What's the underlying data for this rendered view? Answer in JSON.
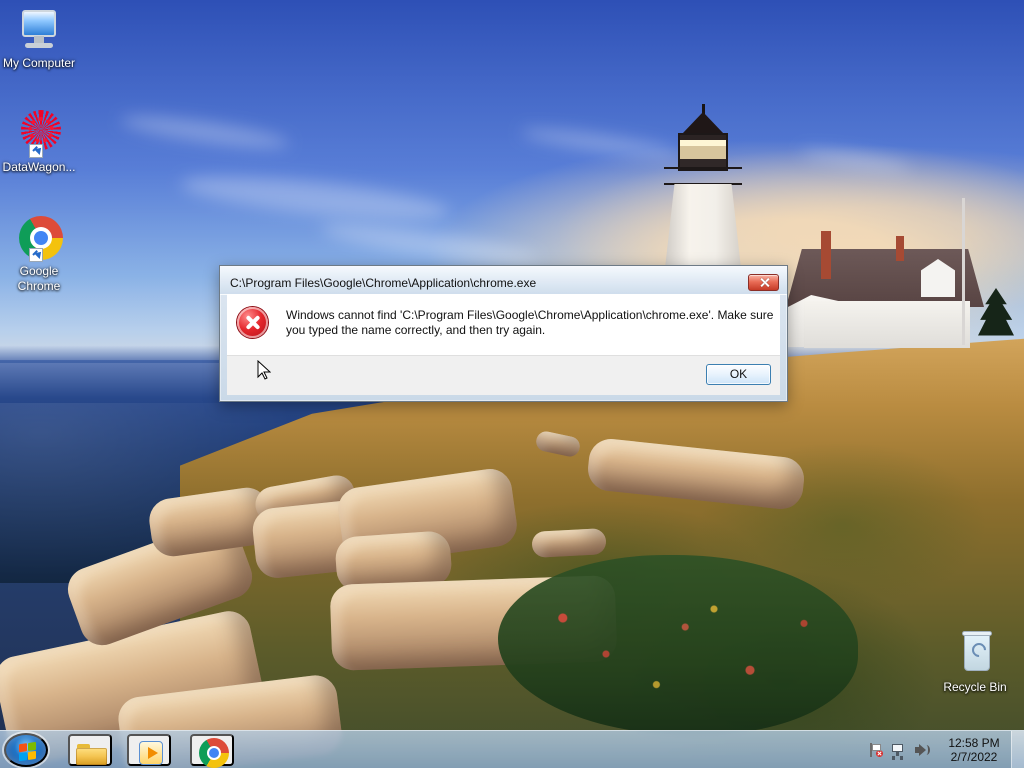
{
  "desktop": {
    "icons": [
      {
        "label": "My Computer",
        "icon": "computer-icon"
      },
      {
        "label": "DataWagon...",
        "icon": "datawagon-icon"
      },
      {
        "label": "Google Chrome",
        "icon": "chrome-icon"
      },
      {
        "label": "Recycle Bin",
        "icon": "recycle-bin-icon"
      }
    ]
  },
  "dialog": {
    "title": "C:\\Program Files\\Google\\Chrome\\Application\\chrome.exe",
    "message": "Windows cannot find 'C:\\Program Files\\Google\\Chrome\\Application\\chrome.exe'. Make sure you typed the name correctly, and then try again.",
    "ok_label": "OK",
    "icon": "error-icon"
  },
  "taskbar": {
    "pinned": [
      {
        "icon": "folder-icon"
      },
      {
        "icon": "media-player-icon"
      },
      {
        "icon": "chrome-icon"
      }
    ],
    "tray_icons": [
      "flag-icon",
      "network-icon",
      "volume-icon"
    ],
    "clock": {
      "time": "12:58 PM",
      "date": "2/7/2022"
    }
  }
}
